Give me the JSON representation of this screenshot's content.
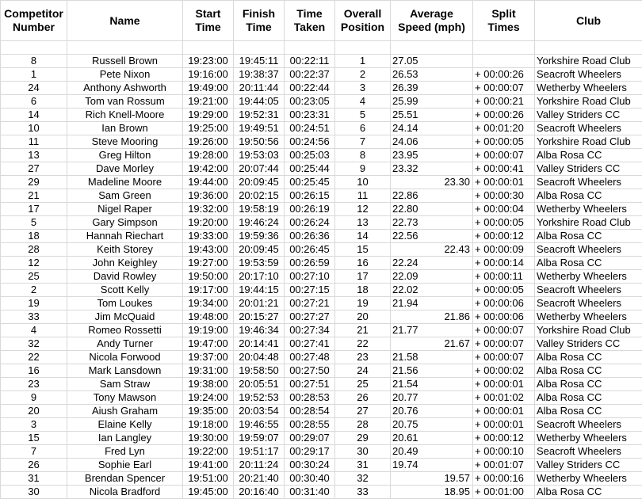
{
  "headers": {
    "competitor_number": "Competitor Number",
    "name": "Name",
    "start_time": "Start Time",
    "finish_time": "Finish Time",
    "time_taken": "Time Taken",
    "overall_position": "Overall Position",
    "average_speed": "Average Speed (mph)",
    "split_times": "Split Times",
    "club": "Club"
  },
  "rows": [
    {
      "num": "8",
      "name": "Russell Brown",
      "start": "19:23:00",
      "finish": "19:45:11",
      "taken": "00:22:11",
      "pos": "1",
      "speed": "27.05",
      "speed_align": "left",
      "split": "",
      "club": "Yorkshire Road Club"
    },
    {
      "num": "1",
      "name": "Pete Nixon",
      "start": "19:16:00",
      "finish": "19:38:37",
      "taken": "00:22:37",
      "pos": "2",
      "speed": "26.53",
      "speed_align": "left",
      "split": "+ 00:00:26",
      "club": "Seacroft Wheelers"
    },
    {
      "num": "24",
      "name": "Anthony Ashworth",
      "start": "19:49:00",
      "finish": "20:11:44",
      "taken": "00:22:44",
      "pos": "3",
      "speed": "26.39",
      "speed_align": "left",
      "split": "+ 00:00:07",
      "club": "Wetherby Wheelers"
    },
    {
      "num": "6",
      "name": "Tom van Rossum",
      "start": "19:21:00",
      "finish": "19:44:05",
      "taken": "00:23:05",
      "pos": "4",
      "speed": "25.99",
      "speed_align": "left",
      "split": "+ 00:00:21",
      "club": "Yorkshire Road Club"
    },
    {
      "num": "14",
      "name": "Rich Knell-Moore",
      "start": "19:29:00",
      "finish": "19:52:31",
      "taken": "00:23:31",
      "pos": "5",
      "speed": "25.51",
      "speed_align": "left",
      "split": "+ 00:00:26",
      "club": "Valley Striders CC"
    },
    {
      "num": "10",
      "name": "Ian Brown",
      "start": "19:25:00",
      "finish": "19:49:51",
      "taken": "00:24:51",
      "pos": "6",
      "speed": "24.14",
      "speed_align": "left",
      "split": "+ 00:01:20",
      "club": "Seacroft Wheelers"
    },
    {
      "num": "11",
      "name": "Steve Mooring",
      "start": "19:26:00",
      "finish": "19:50:56",
      "taken": "00:24:56",
      "pos": "7",
      "speed": "24.06",
      "speed_align": "left",
      "split": "+ 00:00:05",
      "club": "Yorkshire Road Club"
    },
    {
      "num": "13",
      "name": "Greg Hilton",
      "start": "19:28:00",
      "finish": "19:53:03",
      "taken": "00:25:03",
      "pos": "8",
      "speed": "23.95",
      "speed_align": "left",
      "split": "+ 00:00:07",
      "club": "Alba Rosa CC"
    },
    {
      "num": "27",
      "name": "Dave Morley",
      "start": "19:42:00",
      "finish": "20:07:44",
      "taken": "00:25:44",
      "pos": "9",
      "speed": "23.32",
      "speed_align": "left",
      "split": "+ 00:00:41",
      "club": "Valley Striders CC"
    },
    {
      "num": "29",
      "name": "Madeline Moore",
      "start": "19:44:00",
      "finish": "20:09:45",
      "taken": "00:25:45",
      "pos": "10",
      "speed": "23.30",
      "speed_align": "right",
      "split": "+ 00:00:01",
      "club": "Seacroft Wheelers"
    },
    {
      "num": "21",
      "name": "Sam Green",
      "start": "19:36:00",
      "finish": "20:02:15",
      "taken": "00:26:15",
      "pos": "11",
      "speed": "22.86",
      "speed_align": "left",
      "split": "+ 00:00:30",
      "club": "Alba Rosa CC"
    },
    {
      "num": "17",
      "name": "Nigel Raper",
      "start": "19:32:00",
      "finish": "19:58:19",
      "taken": "00:26:19",
      "pos": "12",
      "speed": "22.80",
      "speed_align": "left",
      "split": "+ 00:00:04",
      "club": "Wetherby Wheelers"
    },
    {
      "num": "5",
      "name": "Gary Simpson",
      "start": "19:20:00",
      "finish": "19:46:24",
      "taken": "00:26:24",
      "pos": "13",
      "speed": "22.73",
      "speed_align": "left",
      "split": "+ 00:00:05",
      "club": "Yorkshire Road Club"
    },
    {
      "num": "18",
      "name": "Hannah Riechart",
      "start": "19:33:00",
      "finish": "19:59:36",
      "taken": "00:26:36",
      "pos": "14",
      "speed": "22.56",
      "speed_align": "left",
      "split": "+ 00:00:12",
      "club": "Alba Rosa CC"
    },
    {
      "num": "28",
      "name": "Keith Storey",
      "start": "19:43:00",
      "finish": "20:09:45",
      "taken": "00:26:45",
      "pos": "15",
      "speed": "22.43",
      "speed_align": "right",
      "split": "+ 00:00:09",
      "club": "Seacroft Wheelers"
    },
    {
      "num": "12",
      "name": "John Keighley",
      "start": "19:27:00",
      "finish": "19:53:59",
      "taken": "00:26:59",
      "pos": "16",
      "speed": "22.24",
      "speed_align": "left",
      "split": "+ 00:00:14",
      "club": "Alba Rosa CC"
    },
    {
      "num": "25",
      "name": "David Rowley",
      "start": "19:50:00",
      "finish": "20:17:10",
      "taken": "00:27:10",
      "pos": "17",
      "speed": "22.09",
      "speed_align": "left",
      "split": "+ 00:00:11",
      "club": "Wetherby Wheelers"
    },
    {
      "num": "2",
      "name": "Scott Kelly",
      "start": "19:17:00",
      "finish": "19:44:15",
      "taken": "00:27:15",
      "pos": "18",
      "speed": "22.02",
      "speed_align": "left",
      "split": "+ 00:00:05",
      "club": "Seacroft Wheelers"
    },
    {
      "num": "19",
      "name": "Tom Loukes",
      "start": "19:34:00",
      "finish": "20:01:21",
      "taken": "00:27:21",
      "pos": "19",
      "speed": "21.94",
      "speed_align": "left",
      "split": "+ 00:00:06",
      "club": "Seacroft Wheelers"
    },
    {
      "num": "33",
      "name": "Jim McQuaid",
      "start": "19:48:00",
      "finish": "20:15:27",
      "taken": "00:27:27",
      "pos": "20",
      "speed": "21.86",
      "speed_align": "right",
      "split": "+ 00:00:06",
      "club": "Wetherby Wheelers"
    },
    {
      "num": "4",
      "name": "Romeo Rossetti",
      "start": "19:19:00",
      "finish": "19:46:34",
      "taken": "00:27:34",
      "pos": "21",
      "speed": "21.77",
      "speed_align": "left",
      "split": "+ 00:00:07",
      "club": "Yorkshire Road Club"
    },
    {
      "num": "32",
      "name": "Andy Turner",
      "start": "19:47:00",
      "finish": "20:14:41",
      "taken": "00:27:41",
      "pos": "22",
      "speed": "21.67",
      "speed_align": "right",
      "split": "+ 00:00:07",
      "club": "Valley Striders CC"
    },
    {
      "num": "22",
      "name": "Nicola Forwood",
      "start": "19:37:00",
      "finish": "20:04:48",
      "taken": "00:27:48",
      "pos": "23",
      "speed": "21.58",
      "speed_align": "left",
      "split": "+ 00:00:07",
      "club": "Alba Rosa CC"
    },
    {
      "num": "16",
      "name": "Mark Lansdown",
      "start": "19:31:00",
      "finish": "19:58:50",
      "taken": "00:27:50",
      "pos": "24",
      "speed": "21.56",
      "speed_align": "left",
      "split": "+ 00:00:02",
      "club": "Alba Rosa CC"
    },
    {
      "num": "23",
      "name": "Sam Straw",
      "start": "19:38:00",
      "finish": "20:05:51",
      "taken": "00:27:51",
      "pos": "25",
      "speed": "21.54",
      "speed_align": "left",
      "split": "+ 00:00:01",
      "club": "Alba Rosa CC"
    },
    {
      "num": "9",
      "name": "Tony Mawson",
      "start": "19:24:00",
      "finish": "19:52:53",
      "taken": "00:28:53",
      "pos": "26",
      "speed": "20.77",
      "speed_align": "left",
      "split": "+ 00:01:02",
      "club": "Alba Rosa CC"
    },
    {
      "num": "20",
      "name": "Aiush Graham",
      "start": "19:35:00",
      "finish": "20:03:54",
      "taken": "00:28:54",
      "pos": "27",
      "speed": "20.76",
      "speed_align": "left",
      "split": "+ 00:00:01",
      "club": "Alba Rosa CC"
    },
    {
      "num": "3",
      "name": "Elaine Kelly",
      "start": "19:18:00",
      "finish": "19:46:55",
      "taken": "00:28:55",
      "pos": "28",
      "speed": "20.75",
      "speed_align": "left",
      "split": "+ 00:00:01",
      "club": "Seacroft Wheelers"
    },
    {
      "num": "15",
      "name": "Ian Langley",
      "start": "19:30:00",
      "finish": "19:59:07",
      "taken": "00:29:07",
      "pos": "29",
      "speed": "20.61",
      "speed_align": "left",
      "split": "+ 00:00:12",
      "club": "Wetherby Wheelers"
    },
    {
      "num": "7",
      "name": "Fred Lyn",
      "start": "19:22:00",
      "finish": "19:51:17",
      "taken": "00:29:17",
      "pos": "30",
      "speed": "20.49",
      "speed_align": "left",
      "split": "+ 00:00:10",
      "club": "Seacroft Wheelers"
    },
    {
      "num": "26",
      "name": "Sophie Earl",
      "start": "19:41:00",
      "finish": "20:11:24",
      "taken": "00:30:24",
      "pos": "31",
      "speed": "19.74",
      "speed_align": "left",
      "split": "+ 00:01:07",
      "club": "Valley Striders CC"
    },
    {
      "num": "31",
      "name": "Brendan Spencer",
      "start": "19:51:00",
      "finish": "20:21:40",
      "taken": "00:30:40",
      "pos": "32",
      "speed": "19.57",
      "speed_align": "right",
      "split": "+ 00:00:16",
      "club": "Wetherby Wheelers"
    },
    {
      "num": "30",
      "name": "Nicola Bradford",
      "start": "19:45:00",
      "finish": "20:16:40",
      "taken": "00:31:40",
      "pos": "33",
      "speed": "18.95",
      "speed_align": "right",
      "split": "+ 00:01:00",
      "club": "Alba Rosa CC"
    }
  ]
}
